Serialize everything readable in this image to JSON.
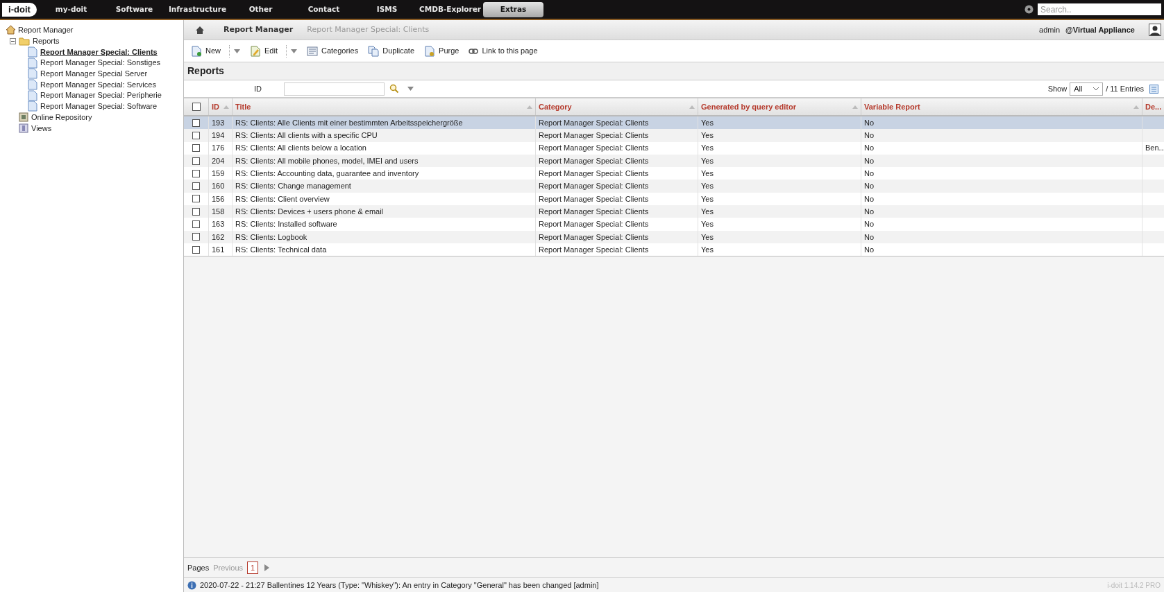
{
  "top_nav": {
    "logo": "i-doit",
    "items": [
      {
        "label": "my-doit",
        "selected": false
      },
      {
        "label": "Software",
        "selected": false
      },
      {
        "label": "Infrastructure",
        "selected": false
      },
      {
        "label": "Other",
        "selected": false
      },
      {
        "label": "Contact",
        "selected": false
      },
      {
        "label": "ISMS",
        "selected": false
      },
      {
        "label": "CMDB-Explorer",
        "selected": false
      },
      {
        "label": "Extras",
        "selected": true
      }
    ],
    "search": {
      "placeholder": "Search.."
    }
  },
  "sidebar": {
    "root": "Report Manager",
    "tree": [
      {
        "label": "Reports",
        "kind": "folder",
        "expanded": true,
        "children": [
          {
            "label": "Report Manager Special: Clients",
            "selected": true
          },
          {
            "label": "Report Manager Special: Sonstiges",
            "selected": false
          },
          {
            "label": "Report Manager Special Server",
            "selected": false
          },
          {
            "label": "Report Manager Special: Services",
            "selected": false
          },
          {
            "label": "Report Manager Special: Peripherie",
            "selected": false
          },
          {
            "label": "Report Manager Special: Software",
            "selected": false
          }
        ]
      },
      {
        "label": "Online Repository",
        "kind": "repository"
      },
      {
        "label": "Views",
        "kind": "views"
      }
    ]
  },
  "breadcrumb": [
    "Report Manager",
    "Report Manager Special: Clients"
  ],
  "user": {
    "name": "admin",
    "tenant": "@Virtual Appliance"
  },
  "toolbar": [
    {
      "label": "New",
      "kind": "new",
      "dropdown": true
    },
    {
      "label": "Edit",
      "kind": "edit",
      "dropdown": true
    },
    {
      "label": "Categories",
      "kind": "categories",
      "dropdown": false
    },
    {
      "label": "Duplicate",
      "kind": "duplicate",
      "dropdown": false
    },
    {
      "label": "Purge",
      "kind": "purge",
      "dropdown": false
    },
    {
      "label": "Link to this page",
      "kind": "link",
      "dropdown": false
    }
  ],
  "section_title": "Reports",
  "filter": {
    "label": "ID"
  },
  "show": {
    "label": "Show",
    "value": "All",
    "entries": "/ 11 Entries"
  },
  "table": {
    "columns": [
      "ID",
      "Title",
      "Category",
      "Generated by query editor",
      "Variable Report",
      "De..."
    ],
    "select_all_checked": false,
    "rows": [
      {
        "id": "193",
        "title": "RS: Clients: Alle Clients mit einer bestimmten Arbeitsspeichergröße",
        "category": "Report Manager Special: Clients",
        "generated": "Yes",
        "variable": "No",
        "checked": false,
        "selected": true
      },
      {
        "id": "194",
        "title": "RS: Clients: All clients with a specific CPU",
        "category": "Report Manager Special: Clients",
        "generated": "Yes",
        "variable": "No",
        "checked": false,
        "selected": false
      },
      {
        "id": "176",
        "title": "RS: Clients: All clients below a location",
        "category": "Report Manager Special: Clients",
        "generated": "Yes",
        "variable": "No",
        "description": "Ben...",
        "checked": false,
        "selected": false
      },
      {
        "id": "204",
        "title": "RS: Clients: All mobile phones, model, IMEI and users",
        "category": "Report Manager Special: Clients",
        "generated": "Yes",
        "variable": "No",
        "checked": false,
        "selected": false
      },
      {
        "id": "159",
        "title": "RS: Clients: Accounting data, guarantee and inventory",
        "category": "Report Manager Special: Clients",
        "generated": "Yes",
        "variable": "No",
        "checked": false,
        "selected": false
      },
      {
        "id": "160",
        "title": "RS: Clients: Change management",
        "category": "Report Manager Special: Clients",
        "generated": "Yes",
        "variable": "No",
        "checked": false,
        "selected": false
      },
      {
        "id": "156",
        "title": "RS: Clients: Client overview",
        "category": "Report Manager Special: Clients",
        "generated": "Yes",
        "variable": "No",
        "checked": false,
        "selected": false
      },
      {
        "id": "158",
        "title": "RS: Clients: Devices + users phone & email",
        "category": "Report Manager Special: Clients",
        "generated": "Yes",
        "variable": "No",
        "checked": false,
        "selected": false
      },
      {
        "id": "163",
        "title": "RS: Clients: Installed software",
        "category": "Report Manager Special: Clients",
        "generated": "Yes",
        "variable": "No",
        "checked": false,
        "selected": false
      },
      {
        "id": "162",
        "title": "RS: Clients: Logbook",
        "category": "Report Manager Special: Clients",
        "generated": "Yes",
        "variable": "No",
        "checked": false,
        "selected": false
      },
      {
        "id": "161",
        "title": "RS: Clients: Technical data",
        "category": "Report Manager Special: Clients",
        "generated": "Yes",
        "variable": "No",
        "checked": false,
        "selected": false
      }
    ]
  },
  "pagination": {
    "label": "Pages",
    "previous": "Previous",
    "pages": [
      {
        "label": "1",
        "selected": true
      }
    ]
  },
  "status_bar": {
    "message": "2020-07-22 - 21:27 Ballentines 12 Years (Type: \"Whiskey\"): An entry in Category \"General\" has been changed [admin]",
    "version": "i-doit 1.14.2 PRO"
  }
}
